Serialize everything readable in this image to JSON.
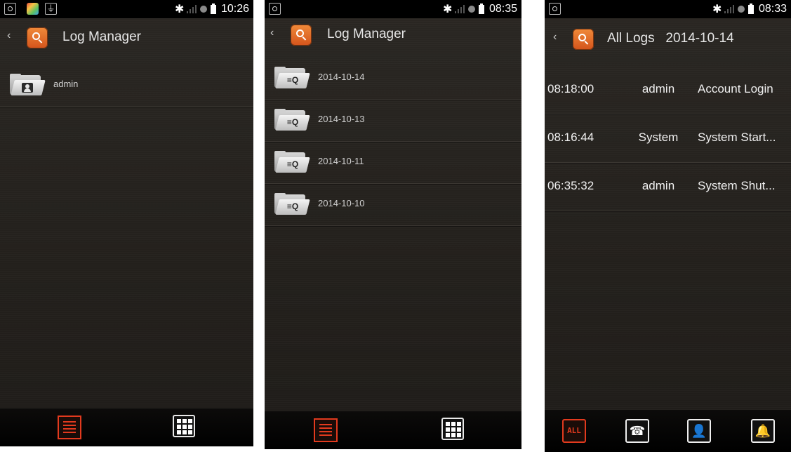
{
  "colors": {
    "accent": "#e23a1e",
    "text": "#e6e6e6",
    "background": "#24211d"
  },
  "screens": [
    {
      "statusbar": {
        "time": "10:26"
      },
      "header": {
        "title": "Log Manager"
      },
      "items": [
        {
          "label": "admin",
          "icon": "user-folder-icon"
        }
      ],
      "bottombar": {
        "buttons": [
          "list-view-icon",
          "grid-view-icon"
        ]
      }
    },
    {
      "statusbar": {
        "time": "08:35"
      },
      "header": {
        "title": "Log Manager"
      },
      "items": [
        {
          "label": "2014-10-14",
          "icon": "log-folder-icon"
        },
        {
          "label": "2014-10-13",
          "icon": "log-folder-icon"
        },
        {
          "label": "2014-10-11",
          "icon": "log-folder-icon"
        },
        {
          "label": "2014-10-10",
          "icon": "log-folder-icon"
        }
      ],
      "bottombar": {
        "buttons": [
          "list-view-icon",
          "grid-view-icon"
        ]
      }
    },
    {
      "statusbar": {
        "time": "08:33"
      },
      "header": {
        "title": "All Logs   2014-10-14"
      },
      "logs": [
        {
          "time": "08:18:00",
          "user": "admin",
          "event": "Account Login"
        },
        {
          "time": "08:16:44",
          "user": "System",
          "event": "System Start..."
        },
        {
          "time": "06:35:32",
          "user": "admin",
          "event": "System Shut..."
        }
      ],
      "filters": {
        "all_label": "ALL",
        "buttons": [
          "all-filter-icon",
          "phone-filter-icon",
          "user-filter-icon",
          "alarm-filter-icon"
        ]
      }
    }
  ]
}
